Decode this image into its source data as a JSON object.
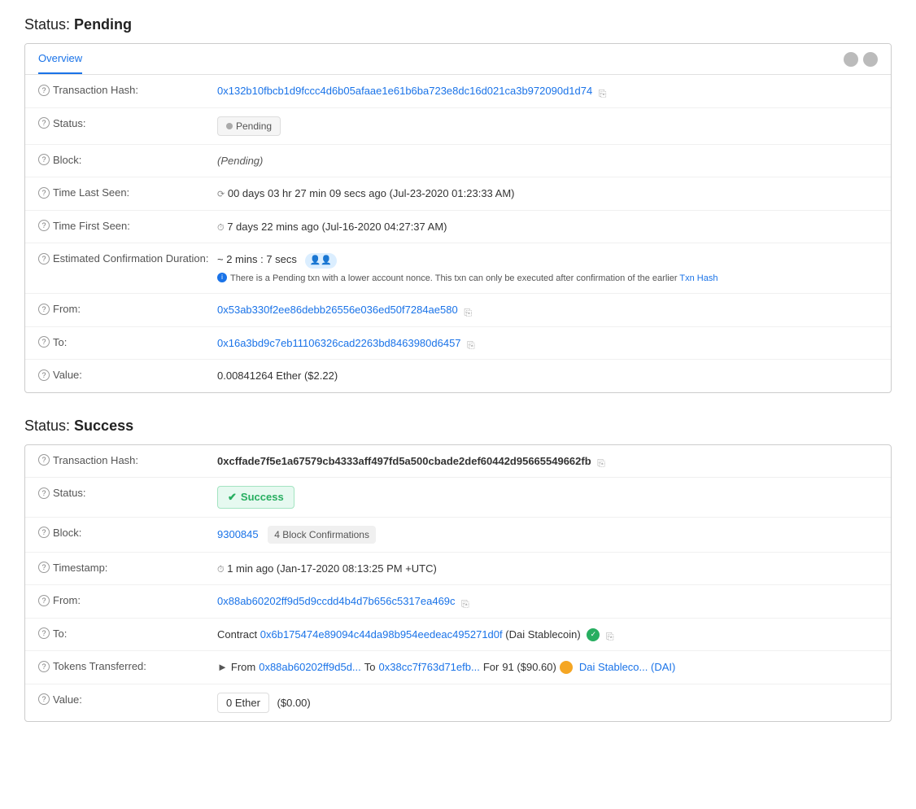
{
  "pending_section": {
    "title": "Status:",
    "title_bold": "Pending",
    "tab_label": "Overview",
    "fields": {
      "transaction_hash": {
        "label": "Transaction Hash:",
        "value": "0x132b10fbcb1d9fccc4d6b05afaae1e61b6ba723e8dc16d021ca3b972090d1d74"
      },
      "status": {
        "label": "Status:",
        "value": "Pending"
      },
      "block": {
        "label": "Block:",
        "value": "(Pending)"
      },
      "time_last_seen": {
        "label": "Time Last Seen:",
        "value": "00 days 03 hr 27 min 09 secs ago (Jul-23-2020 01:23:33 AM)"
      },
      "time_first_seen": {
        "label": "Time First Seen:",
        "value": "7 days 22 mins ago (Jul-16-2020 04:27:37 AM)"
      },
      "estimated_confirmation": {
        "label": "Estimated Confirmation Duration:",
        "value": "~ 2 mins : 7 secs",
        "note": "There is a Pending txn with a lower account nonce. This txn can only be executed after confirmation of the earlier Txn Hash"
      },
      "from": {
        "label": "From:",
        "value": "0x53ab330f2ee86debb26556e036ed50f7284ae580"
      },
      "to": {
        "label": "To:",
        "value": "0x16a3bd9c7eb11106326cad2263bd8463980d6457"
      },
      "value": {
        "label": "Value:",
        "value": "0.00841264 Ether ($2.22)"
      }
    }
  },
  "success_section": {
    "title": "Status:",
    "title_bold": "Success",
    "fields": {
      "transaction_hash": {
        "label": "Transaction Hash:",
        "value": "0xcffade7f5e1a67579cb4333aff497fd5a500cbade2def60442d95665549662fb"
      },
      "status": {
        "label": "Status:",
        "value": "Success"
      },
      "block": {
        "label": "Block:",
        "block_number": "9300845",
        "confirmations": "4 Block Confirmations"
      },
      "timestamp": {
        "label": "Timestamp:",
        "value": "1 min ago (Jan-17-2020 08:13:25 PM +UTC)"
      },
      "from": {
        "label": "From:",
        "value": "0x88ab60202ff9d5d9ccdd4b4d7b656c5317ea469c"
      },
      "to": {
        "label": "To:",
        "contract_prefix": "Contract",
        "contract_address": "0x6b175474e89094c44da98b954eedeac495271d0f",
        "contract_name": "(Dai Stablecoin)"
      },
      "tokens_transferred": {
        "label": "Tokens Transferred:",
        "from_address": "0x88ab60202ff9d5d...",
        "to_address": "0x38cc7f763d71efb...",
        "amount": "91 ($90.60)",
        "token_name": "Dai Stableco... (DAI)"
      },
      "value": {
        "label": "Value:",
        "amount": "0 Ether",
        "usd": "($0.00)"
      }
    }
  }
}
